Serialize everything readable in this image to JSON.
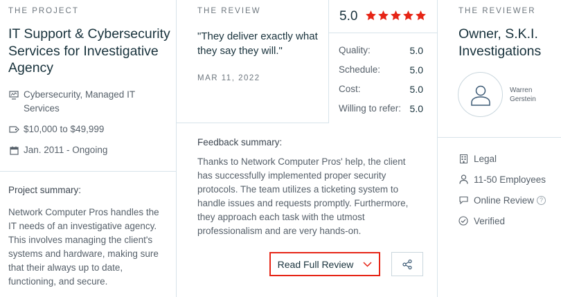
{
  "project": {
    "eyebrow": "THE PROJECT",
    "title": "IT Support & Cybersecurity Services for Investigative Agency",
    "meta": [
      {
        "icon": "services-icon",
        "text": "Cybersecurity, Managed IT Services"
      },
      {
        "icon": "price-tag-icon",
        "text": "$10,000 to $49,999"
      },
      {
        "icon": "calendar-icon",
        "text": "Jan. 2011 - Ongoing"
      }
    ],
    "summary_label": "Project summary:",
    "summary_text": "Network Computer Pros handles the IT needs of an investigative agency. This involves managing the client's systems and hardware, making sure that their always up to date, functioning, and secure."
  },
  "review": {
    "eyebrow": "THE REVIEW",
    "quote": "\"They deliver exactly what they say they will.\"",
    "date": "MAR 11, 2022",
    "overall_score": "5.0",
    "stars": 5,
    "star_color": "#e62415",
    "scores": [
      {
        "label": "Quality:",
        "value": "5.0"
      },
      {
        "label": "Schedule:",
        "value": "5.0"
      },
      {
        "label": "Cost:",
        "value": "5.0"
      },
      {
        "label": "Willing to refer:",
        "value": "5.0"
      }
    ],
    "feedback_label": "Feedback summary:",
    "feedback_text": "Thanks to Network Computer Pros' help, the client has successfully implemented proper security protocols. The team utilizes a ticketing system to handle issues and requests promptly. Furthermore, they approach each task with the utmost professionalism and are very hands-on.",
    "read_full_label": "Read Full Review",
    "accent_color": "#e62415"
  },
  "reviewer": {
    "eyebrow": "THE REVIEWER",
    "title": "Owner, S.K.I. Investigations",
    "name": "Warren Gerstein",
    "details": [
      {
        "icon": "building-icon",
        "text": "Legal"
      },
      {
        "icon": "person-icon",
        "text": "11-50 Employees"
      },
      {
        "icon": "chat-bubble-icon",
        "text": "Online Review"
      },
      {
        "icon": "check-circle-icon",
        "text": "Verified"
      }
    ]
  }
}
